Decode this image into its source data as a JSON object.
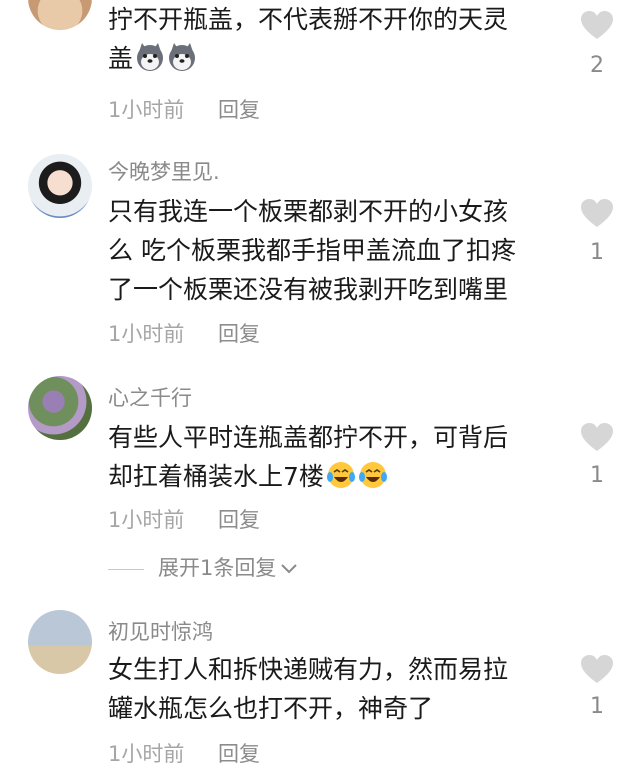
{
  "comments": [
    {
      "username": "",
      "lines": [
        "拧不开瓶盖，不代表掰不开你的天灵",
        "盖"
      ],
      "emoji": [
        "husky-emoji",
        "husky-emoji"
      ],
      "time": "1小时前",
      "reply": "回复",
      "likes": "2"
    },
    {
      "username": "今晚梦里见.",
      "lines": [
        "只有我连一个板栗都剥不开的小女孩",
        "么 吃个板栗我都手指甲盖流血了扣疼",
        "了一个板栗还没有被我剥开吃到嘴里"
      ],
      "time": "1小时前",
      "reply": "回复",
      "likes": "1"
    },
    {
      "username": "心之千行",
      "lines": [
        "有些人平时连瓶盖都拧不开，可背后",
        "却扛着桶装水上7楼"
      ],
      "emoji": [
        "laugh-cry-emoji",
        "laugh-cry-emoji"
      ],
      "time": "1小时前",
      "reply": "回复",
      "likes": "1"
    },
    {
      "username": "初见时惊鸿",
      "lines": [
        "女生打人和拆快递贼有力，然而易拉",
        "罐水瓶怎么也打不开，神奇了"
      ],
      "time": "1小时前",
      "reply": "回复",
      "likes": "1"
    }
  ],
  "expand_replies": "展开1条回复",
  "colors": {
    "heart": "#d6d6d6",
    "meta": "#a6a6a6",
    "username": "#8a8a8a"
  }
}
